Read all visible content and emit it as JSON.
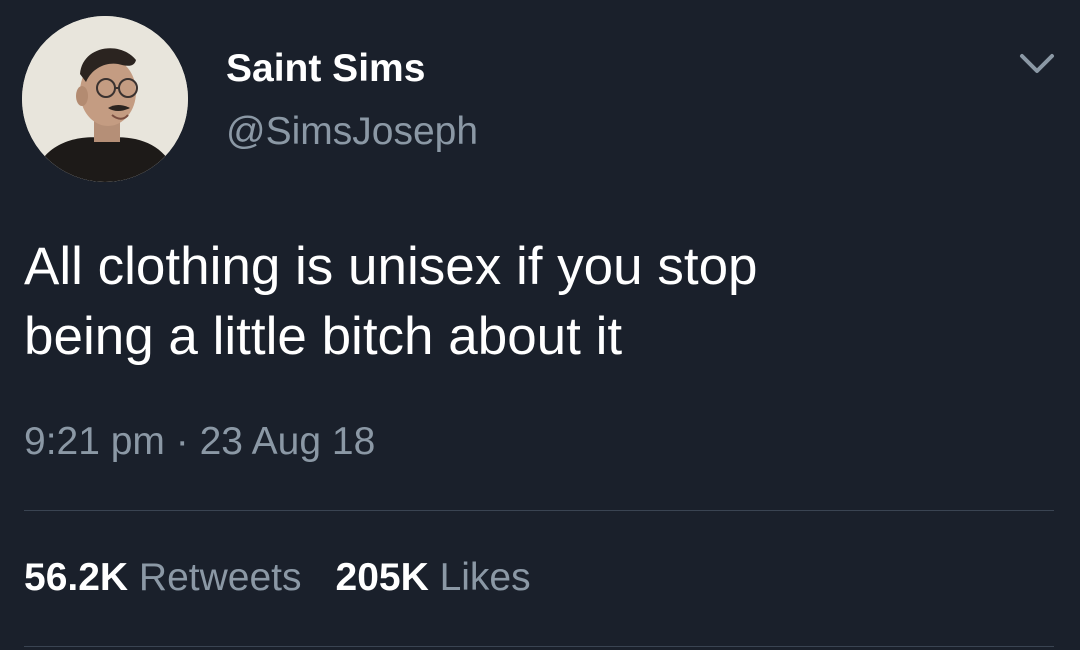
{
  "author": {
    "display_name": "Saint Sims",
    "handle": "@SimsJoseph",
    "avatar_icon": "profile-photo"
  },
  "tweet": {
    "text_lines": [
      "All clothing is unisex if you stop",
      "being a little bitch about it"
    ],
    "time": "9:21 pm",
    "separator": "·",
    "date": "23 Aug 18"
  },
  "stats": {
    "retweets_count": "56.2K",
    "retweets_label": "Retweets",
    "likes_count": "205K",
    "likes_label": "Likes"
  },
  "colors": {
    "background": "#1a202b",
    "primary_text": "#ffffff",
    "secondary_text": "#8b98a5",
    "divider": "#3a4452"
  }
}
